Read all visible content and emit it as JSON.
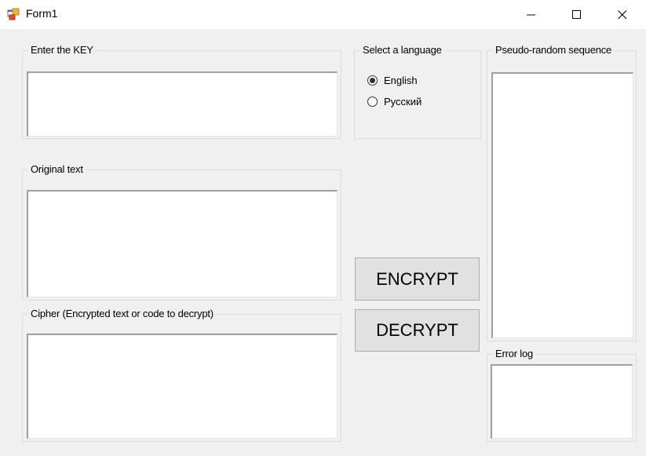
{
  "window": {
    "title": "Form1",
    "app_icon": "winforms-app-icon",
    "controls": {
      "minimize_icon": "minimize-icon",
      "maximize_icon": "maximize-icon",
      "close_icon": "close-icon"
    }
  },
  "key_group": {
    "title": "Enter the KEY",
    "value": ""
  },
  "original_group": {
    "title": "Original text",
    "value": ""
  },
  "cipher_group": {
    "title": "Cipher (Encrypted text or code to decrypt)",
    "value": ""
  },
  "language_group": {
    "title": "Select a language",
    "options": [
      {
        "label": "English",
        "checked": true
      },
      {
        "label": "Русский",
        "checked": false
      }
    ]
  },
  "buttons": {
    "encrypt_label": "ENCRYPT",
    "decrypt_label": "DECRYPT"
  },
  "sequence_group": {
    "title": "Pseudo-random sequence",
    "value": ""
  },
  "error_group": {
    "title": "Error log",
    "value": ""
  },
  "colors": {
    "window_background": "#f0f0f0",
    "titlebar_background": "#ffffff",
    "button_face": "#e1e1e1",
    "button_border": "#adadad",
    "groupbox_border": "#dcdcdc"
  }
}
